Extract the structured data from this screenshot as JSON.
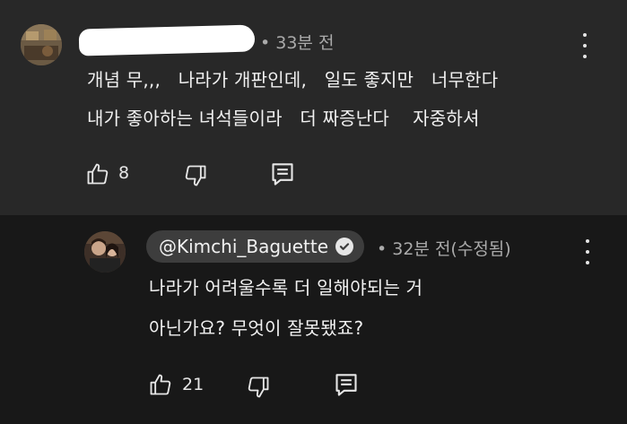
{
  "top_comment": {
    "time": "• 33분 전",
    "lines": [
      "개념 무,,,   나라가 개판인데,   일도 좋지만   너무한다",
      "내가 좋아하는 녀석들이라   더 짜증난다    자중하셔"
    ],
    "like_count": "8",
    "icons": {
      "like": "thumbs-up-icon",
      "dislike": "thumbs-down-icon",
      "reply": "reply-comment-icon",
      "more": "more-vert-icon"
    }
  },
  "reply_comment": {
    "handle": "@Kimchi_Baguette",
    "time": "• 32분 전(수정됨)",
    "lines": [
      "나라가 어려울수록 더 일해야되는 거",
      "아닌가요? 무엇이 잘못됐죠?"
    ],
    "like_count": "21",
    "icons": {
      "verified": "verified-check-icon",
      "like": "thumbs-up-icon",
      "dislike": "thumbs-down-icon",
      "reply": "reply-comment-icon",
      "more": "more-vert-icon"
    }
  }
}
